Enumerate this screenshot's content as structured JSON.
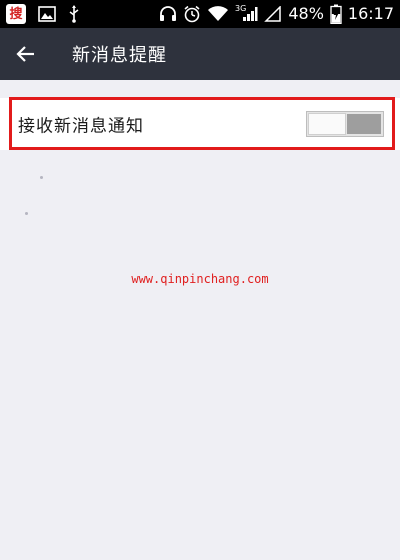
{
  "status_bar": {
    "app_badge": "搜",
    "network_label": "3G",
    "battery_percent": "48%",
    "time": "16:17",
    "icons": [
      "app-badge-icon",
      "image-icon",
      "usb-icon",
      "headset-icon",
      "alarm-icon",
      "wifi-icon",
      "signal-icon",
      "no-sim-signal-icon",
      "battery-charging-icon"
    ]
  },
  "header": {
    "back_icon": "arrow-left-icon",
    "title": "新消息提醒"
  },
  "settings": {
    "receive_notifications_label": "接收新消息通知",
    "receive_notifications_enabled": false
  },
  "watermark": {
    "text": "www.qinpinchang.com"
  },
  "colors": {
    "status_bar": "#000000",
    "header_bg": "#2e323d",
    "page_bg": "#efeff4",
    "highlight": "#e21b1b",
    "watermark": "#e02020"
  }
}
